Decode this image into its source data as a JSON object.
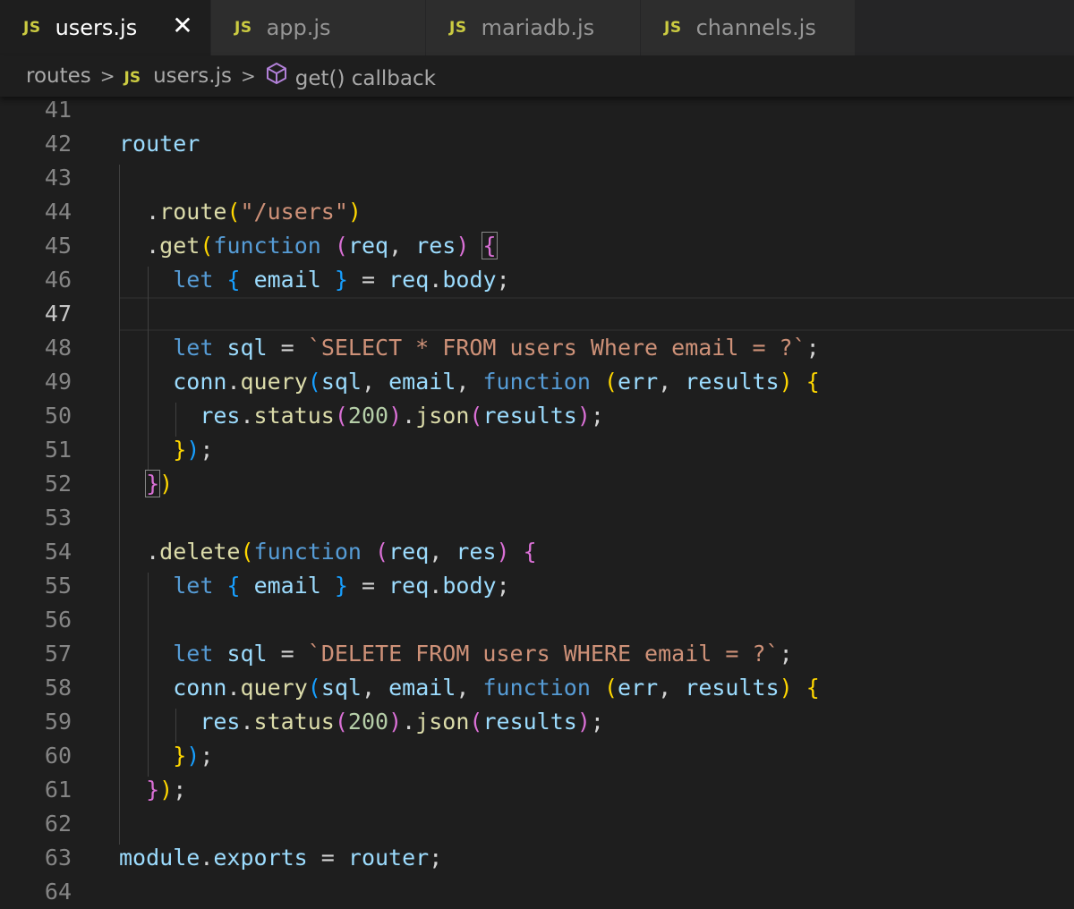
{
  "tabs": [
    {
      "icon": "JS",
      "label": "users.js",
      "active": true,
      "close": "✕"
    },
    {
      "icon": "JS",
      "label": "app.js"
    },
    {
      "icon": "JS",
      "label": "mariadb.js"
    },
    {
      "icon": "JS",
      "label": "channels.js"
    }
  ],
  "breadcrumb": {
    "folder": "routes",
    "file_icon": "JS",
    "file": "users.js",
    "symbol": "get() callback",
    "separator": ">"
  },
  "editor": {
    "current_line": 47,
    "line_numbers": [
      "41",
      "42",
      "43",
      "44",
      "45",
      "46",
      "47",
      "48",
      "49",
      "50",
      "51",
      "52",
      "53",
      "54",
      "55",
      "56",
      "57",
      "58",
      "59",
      "60",
      "61",
      "62",
      "63",
      "64"
    ],
    "tokens": {
      "router": "router",
      "route": "route",
      "route_path": "\"/users\"",
      "get": "get",
      "function": "function",
      "req": "req",
      "res": "res",
      "let": "let",
      "email": "email",
      "body": "body",
      "sql": "sql",
      "select_sql": "`SELECT * FROM users Where email = ?`",
      "conn": "conn",
      "query": "query",
      "err": "err",
      "results": "results",
      "status": "status",
      "code_200": "200",
      "json": "json",
      "delete": "delete",
      "delete_sql": "`DELETE FROM users WHERE email = ?`",
      "module": "module",
      "exports": "exports"
    }
  },
  "colors": {
    "background": "#1e1e1e",
    "tabbar": "#252526",
    "js_icon": "#cbcb41",
    "keyword": "#569cd6",
    "variable": "#9cdcfe",
    "function": "#dcdcaa",
    "string": "#ce9178",
    "number": "#b5cea8",
    "bracket_gold": "#ffd700",
    "bracket_orchid": "#da70d6",
    "bracket_blue": "#179fff"
  }
}
